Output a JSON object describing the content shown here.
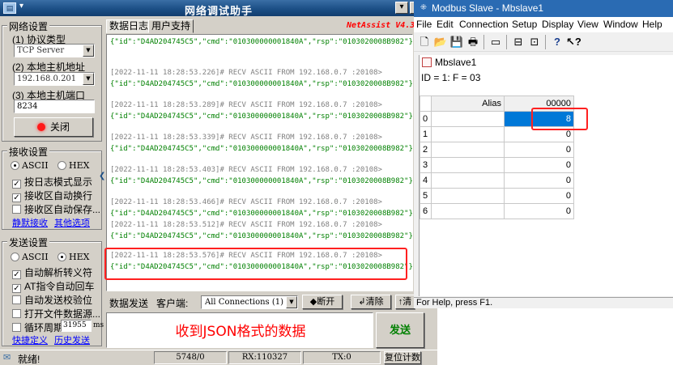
{
  "netassist": {
    "title": "网络调试助手",
    "version_banner": "NetAssist V4.3",
    "net_settings": {
      "group_title": "网络设置",
      "protocol_label": "(1) 协议类型",
      "protocol_value": "TCP Server",
      "host_ip_label": "(2) 本地主机地址",
      "host_ip_value": "192.168.0.201",
      "port_label": "(3) 本地主机端口",
      "port_value": "8234",
      "close_button": "关闭"
    },
    "recv_settings": {
      "group_title": "接收设置",
      "ascii": "ASCII",
      "hex": "HEX",
      "selected": "ASCII",
      "log_mode": "按日志模式显示",
      "auto_wrap": "接收区自动换行",
      "save_to_file": "接收区自动保存...",
      "link_mute": "静默接收",
      "link_other": "其他选项"
    },
    "send_settings": {
      "group_title": "发送设置",
      "ascii": "ASCII",
      "hex": "HEX",
      "selected": "HEX",
      "auto_escape": "自动解析转义符",
      "at_newline": "AT指令自动回车",
      "auto_checksum": "自动发送校验位",
      "open_file": "打开文件数据源...",
      "loop_period": "循环周期",
      "loop_value": "31955",
      "loop_unit": "ms",
      "link_quick": "快捷定义",
      "link_history": "历史发送"
    },
    "tabs": [
      "数据日志",
      "用户支持"
    ],
    "log_entries": [
      {
        "header": "",
        "data": "{\"id\":\"D4AD204745C5\",\"cmd\":\"010300000001840A\",\"rsp\":\"0103020008B982\"}"
      },
      {
        "header": "[2022-11-11 18:28:53.226]# RECV ASCII FROM 192.168.0.7 :20108>",
        "data": "{\"id\":\"D4AD204745C5\",\"cmd\":\"010300000001840A\",\"rsp\":\"0103020008B982\"}"
      },
      {
        "header": "[2022-11-11 18:28:53.289]# RECV ASCII FROM 192.168.0.7 :20108>",
        "data": "{\"id\":\"D4AD204745C5\",\"cmd\":\"010300000001840A\",\"rsp\":\"0103020008B982\"}"
      },
      {
        "header": "[2022-11-11 18:28:53.339]# RECV ASCII FROM 192.168.0.7 :20108>",
        "data": "{\"id\":\"D4AD204745C5\",\"cmd\":\"010300000001840A\",\"rsp\":\"0103020008B982\"}"
      },
      {
        "header": "[2022-11-11 18:28:53.403]# RECV ASCII FROM 192.168.0.7 :20108>",
        "data": "{\"id\":\"D4AD204745C5\",\"cmd\":\"010300000001840A\",\"rsp\":\"0103020008B982\"}"
      },
      {
        "header": "[2022-11-11 18:28:53.466]# RECV ASCII FROM 192.168.0.7 :20108>",
        "data": "{\"id\":\"D4AD204745C5\",\"cmd\":\"010300000001840A\",\"rsp\":\"0103020008B982\"}"
      },
      {
        "header": "[2022-11-11 18:28:53.512]# RECV ASCII FROM 192.168.0.7 :20108>",
        "data": "{\"id\":\"D4AD204745C5\",\"cmd\":\"010300000001840A\",\"rsp\":\"0103020008B982\"}"
      },
      {
        "header": "[2022-11-11 18:28:53.576]# RECV ASCII FROM 192.168.0.7 :20108>",
        "data": "{\"id\":\"D4AD204745C5\",\"cmd\":\"010300000001840A\",\"rsp\":\"0103020008B982\"}"
      }
    ],
    "send_bar": {
      "data_send": "数据发送",
      "client_label": "客户端:",
      "connections": "All Connections (1)",
      "disconnect": "断开",
      "clear": "清除",
      "clear2": "清"
    },
    "send_area_text": "收到JSON格式的数据",
    "send_button": "发送",
    "status": {
      "ready": "就绪!",
      "counter": "5748/0",
      "rx": "RX:110327",
      "tx": "TX:0",
      "reset": "复位计数"
    }
  },
  "modbus": {
    "title": "Modbus Slave - Mbslave1",
    "menu": [
      "File",
      "Edit",
      "Connection",
      "Setup",
      "Display",
      "View",
      "Window",
      "Help"
    ],
    "toolbar_icons": [
      "new-icon",
      "open-icon",
      "save-icon",
      "print-icon",
      "window-icon",
      "display-icon",
      "lock-icon",
      "help-icon",
      "context-help-icon"
    ],
    "child_title": "Mbslave1",
    "info": "ID = 1: F = 03",
    "grid": {
      "alias_header": "Alias",
      "value_header": "00000",
      "rows": [
        {
          "index": "0",
          "alias": "",
          "value": "8"
        },
        {
          "index": "1",
          "alias": "",
          "value": "0"
        },
        {
          "index": "2",
          "alias": "",
          "value": "0"
        },
        {
          "index": "3",
          "alias": "",
          "value": "0"
        },
        {
          "index": "4",
          "alias": "",
          "value": "0"
        },
        {
          "index": "5",
          "alias": "",
          "value": "0"
        },
        {
          "index": "6",
          "alias": "",
          "value": "0"
        }
      ]
    },
    "status": "For Help, press F1."
  },
  "colors": {
    "accent_blue": "#2a6bb3",
    "highlight_red": "#ff2020",
    "recv_green": "#008000"
  }
}
